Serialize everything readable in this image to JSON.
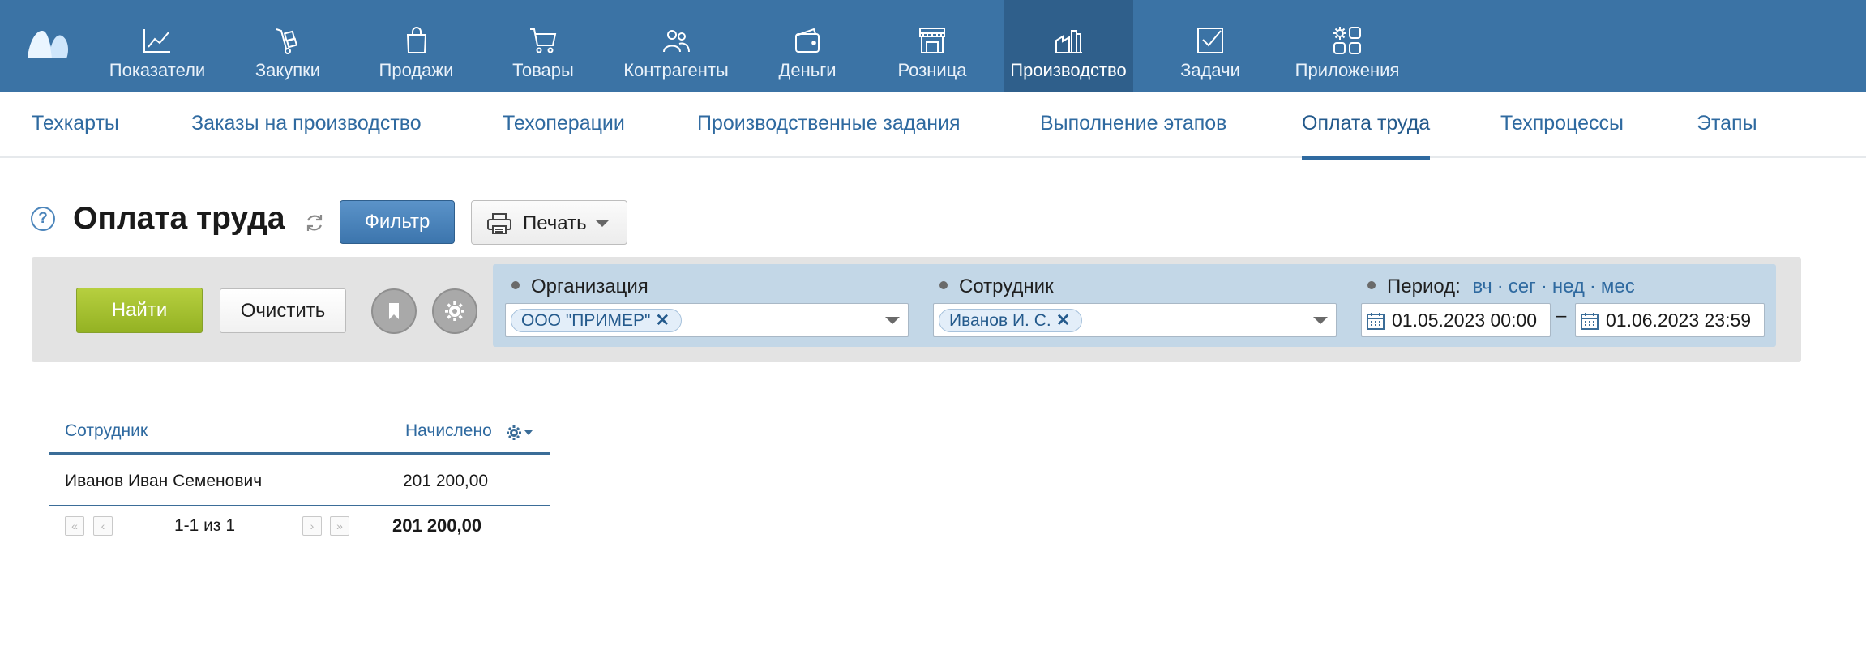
{
  "topnav": {
    "items": [
      {
        "label": "Показатели",
        "icon": "chart-line-icon"
      },
      {
        "label": "Закупки",
        "icon": "hand-truck-icon"
      },
      {
        "label": "Продажи",
        "icon": "shopping-bag-icon"
      },
      {
        "label": "Товары",
        "icon": "cart-icon"
      },
      {
        "label": "Контрагенты",
        "icon": "people-icon"
      },
      {
        "label": "Деньги",
        "icon": "wallet-icon"
      },
      {
        "label": "Розница",
        "icon": "storefront-icon"
      },
      {
        "label": "Производство",
        "icon": "factory-icon",
        "active": true
      },
      {
        "label": "Задачи",
        "icon": "checkbox-icon"
      },
      {
        "label": "Приложения",
        "icon": "apps-icon"
      }
    ],
    "bg_color": "#3b73a5",
    "active_color": "#2f5f8b"
  },
  "subnav": {
    "items": [
      {
        "label": "Техкарты"
      },
      {
        "label": "Заказы на производство"
      },
      {
        "label": "Техоперации"
      },
      {
        "label": "Производственные задания"
      },
      {
        "label": "Выполнение этапов"
      },
      {
        "label": "Оплата труда",
        "active": true
      },
      {
        "label": "Техпроцессы"
      },
      {
        "label": "Этапы"
      }
    ]
  },
  "page": {
    "help": "?",
    "title": "Оплата труда",
    "filter_button": "Фильтр",
    "print_button": "Печать"
  },
  "filter": {
    "find_button": "Найти",
    "clear_button": "Очистить",
    "organization": {
      "label": "Организация",
      "tag": "ООО \"ПРИМЕР\""
    },
    "employee": {
      "label": "Сотрудник",
      "tag": "Иванов И. С."
    },
    "period": {
      "label": "Период:",
      "shortcuts": [
        "вч",
        "сег",
        "нед",
        "мес"
      ],
      "from": "01.05.2023 00:00",
      "to": "01.06.2023 23:59",
      "dash": "–"
    }
  },
  "table": {
    "columns": [
      "Сотрудник",
      "Начислено"
    ],
    "rows": [
      {
        "employee": "Иванов Иван Семенович",
        "accrued": "201 200,00"
      }
    ],
    "pagination": "1-1 из 1",
    "total": "201 200,00"
  },
  "colors": {
    "accent": "#2f6aa0",
    "find_green": "#9bb92a",
    "filter_area": "#c3d7e7"
  }
}
